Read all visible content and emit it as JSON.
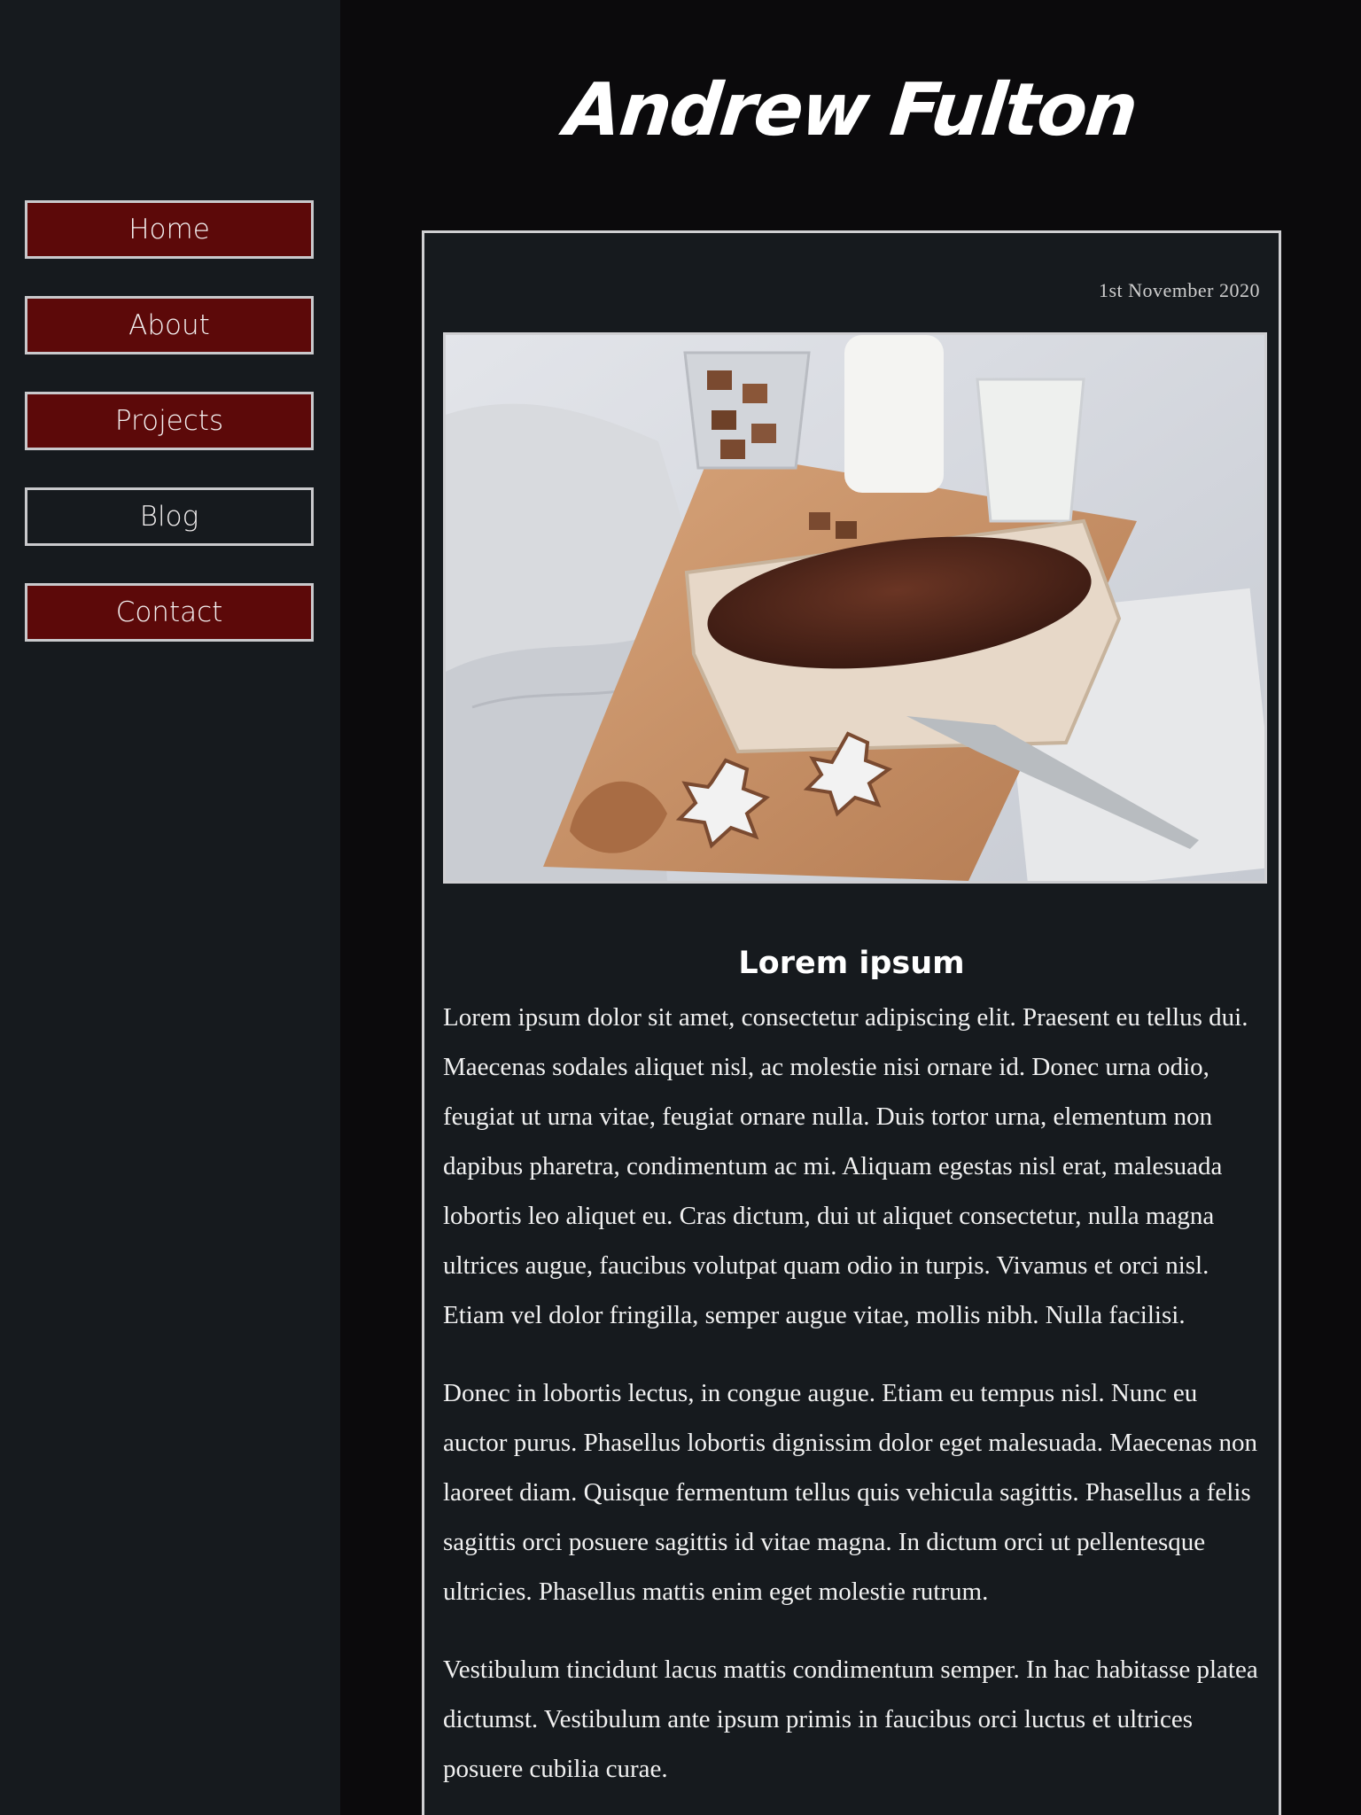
{
  "nav": {
    "items": [
      {
        "label": "Home",
        "active": false
      },
      {
        "label": "About",
        "active": false
      },
      {
        "label": "Projects",
        "active": false
      },
      {
        "label": "Blog",
        "active": true
      },
      {
        "label": "Contact",
        "active": false
      }
    ]
  },
  "header": {
    "title": "Andrew Fulton"
  },
  "post": {
    "date": "1st November 2020",
    "image_description": "photo-loaf-cake-on-cutting-board",
    "title": "Lorem ipsum",
    "paragraphs": [
      "Lorem ipsum dolor sit amet, consectetur adipiscing elit. Praesent eu tellus dui. Maecenas sodales aliquet nisl, ac molestie nisi ornare id. Donec urna odio, feugiat ut urna vitae, feugiat ornare nulla. Duis tortor urna, elementum non dapibus pharetra, condimentum ac mi. Aliquam egestas nisl erat, malesuada lobortis leo aliquet eu. Cras dictum, dui ut aliquet consectetur, nulla magna ultrices augue, faucibus volutpat quam odio in turpis. Vivamus et orci nisl. Etiam vel dolor fringilla, semper augue vitae, mollis nibh. Nulla facilisi.",
      "Donec in lobortis lectus, in congue augue. Etiam eu tempus nisl. Nunc eu auctor purus. Phasellus lobortis dignissim dolor eget malesuada. Maecenas non laoreet diam. Quisque fermentum tellus quis vehicula sagittis. Phasellus a felis sagittis orci posuere sagittis id vitae magna. In dictum orci ut pellentesque ultricies. Phasellus mattis enim eget molestie rutrum.",
      "Vestibulum tincidunt lacus mattis condimentum semper. In hac habitasse platea dictumst. Vestibulum ante ipsum primis in faucibus orci luctus et ultrices posuere cubilia curae."
    ]
  },
  "colors": {
    "sidebar_bg": "#161a1e",
    "main_bg": "#0b0a0c",
    "nav_button_bg": "#5c0909",
    "border": "#cfcfd2",
    "text": "#ffffff"
  }
}
